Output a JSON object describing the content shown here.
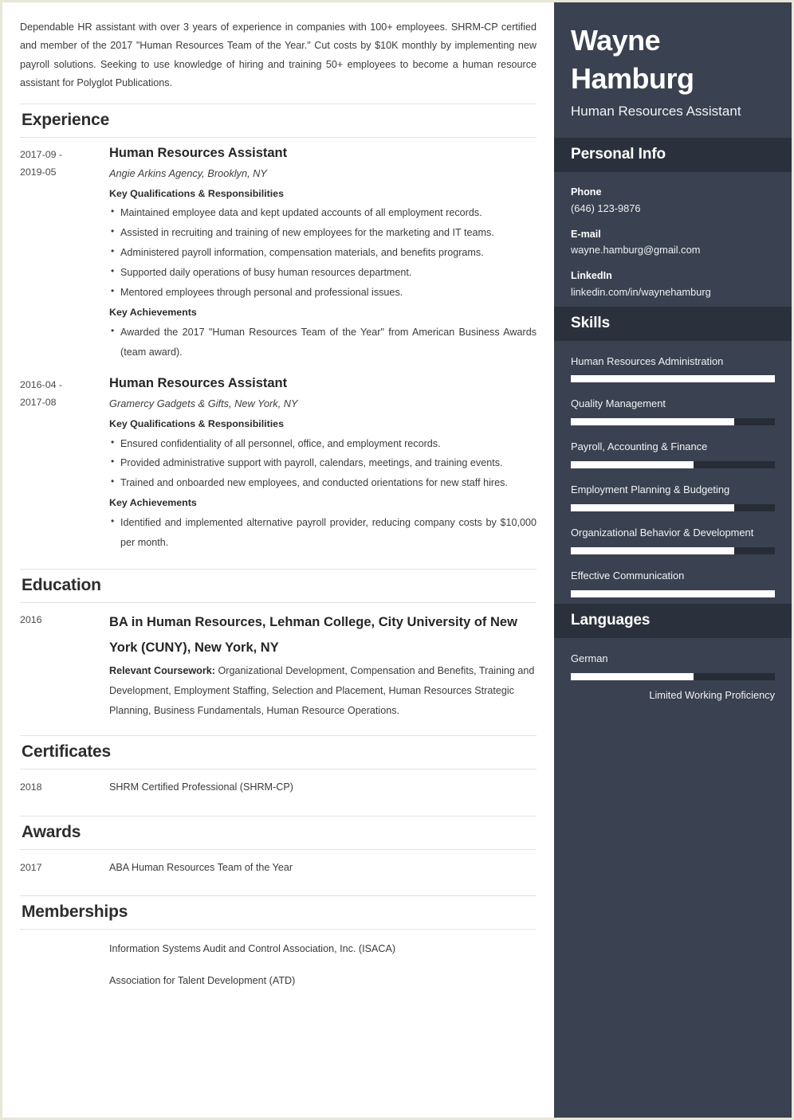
{
  "colors": {
    "sidebar_bg": "#3a4150",
    "sidebar_band_bg": "#2b313c",
    "bar_fill": "#ffffff",
    "bar_track": "#272c36",
    "page_border": "#e8e7d8"
  },
  "main": {
    "summary": "Dependable HR assistant with over 3 years of experience in companies with 100+ employees. SHRM-CP certified and member of the 2017 \"Human Resources Team of the Year.\" Cut costs by $10K monthly by implementing new payroll solutions. Seeking to use knowledge of hiring and training 50+ employees to become a human resource assistant for Polyglot Publications.",
    "sections": {
      "experience_title": "Experience",
      "education_title": "Education",
      "certificates_title": "Certificates",
      "awards_title": "Awards",
      "memberships_title": "Memberships"
    },
    "experience": [
      {
        "date": "2017-09 - 2019-05",
        "date_line1": "2017-09 -",
        "date_line2": "2019-05",
        "title": "Human Resources Assistant",
        "company": "Angie Arkins Agency, Brooklyn, NY",
        "qualifications_heading": "Key Qualifications & Responsibilities",
        "qualifications": [
          "Maintained employee data and kept updated accounts of all employment records.",
          "Assisted in recruiting and training of new employees for the marketing and IT teams.",
          "Administered payroll information, compensation materials, and benefits programs.",
          "Supported daily operations of busy human resources department.",
          "Mentored employees through personal and professional issues."
        ],
        "achievements_heading": "Key Achievements",
        "achievements": [
          "Awarded the 2017 \"Human Resources Team of the Year\" from American Business Awards (team award)."
        ]
      },
      {
        "date": "2016-04 - 2017-08",
        "date_line1": "2016-04 -",
        "date_line2": "2017-08",
        "title": "Human Resources Assistant",
        "company": "Gramercy Gadgets & Gifts, New York, NY",
        "qualifications_heading": "Key Qualifications & Responsibilities",
        "qualifications": [
          "Ensured confidentiality of all personnel, office, and employment records.",
          "Provided administrative support with payroll, calendars, meetings, and training events.",
          "Trained and onboarded new employees, and conducted orientations for new staff hires."
        ],
        "achievements_heading": "Key Achievements",
        "achievements": [
          "Identified and implemented alternative payroll provider, reducing company costs by $10,000 per month."
        ]
      }
    ],
    "education": [
      {
        "date": "2016",
        "title": "BA in Human Resources, Lehman College, City University of New York (CUNY), New York, NY",
        "coursework_label": "Relevant Coursework:",
        "coursework_text": " Organizational Development, Compensation and Benefits, Training and Development, Employment Staffing, Selection and Placement, Human Resources Strategic Planning, Business Fundamentals, Human Resource Operations."
      }
    ],
    "certificates": [
      {
        "date": "2018",
        "text": "SHRM Certified Professional (SHRM-CP)"
      }
    ],
    "awards": [
      {
        "date": "2017",
        "text": "ABA Human Resources Team of the Year"
      }
    ],
    "memberships": [
      "Information Systems Audit and Control Association, Inc. (ISACA)",
      "Association for Talent Development (ATD)"
    ]
  },
  "sidebar": {
    "name": "Wayne Hamburg",
    "role": "Human Resources Assistant",
    "personal_info_title": "Personal Info",
    "contacts": [
      {
        "label": "Phone",
        "value": "(646) 123-9876"
      },
      {
        "label": "E-mail",
        "value": "wayne.hamburg@gmail.com"
      },
      {
        "label": "LinkedIn",
        "value": "linkedin.com/in/waynehamburg"
      }
    ],
    "skills_title": "Skills",
    "skills": [
      {
        "name": "Human Resources Administration",
        "level": 100
      },
      {
        "name": "Quality Management",
        "level": 80
      },
      {
        "name": "Payroll, Accounting & Finance",
        "level": 60
      },
      {
        "name": "Employment Planning & Budgeting",
        "level": 80
      },
      {
        "name": "Organizational Behavior & Development",
        "level": 80
      },
      {
        "name": "Effective Communication",
        "level": 100
      }
    ],
    "languages_title": "Languages",
    "languages": [
      {
        "name": "German",
        "level": 60,
        "proficiency": "Limited Working Proficiency"
      }
    ]
  }
}
